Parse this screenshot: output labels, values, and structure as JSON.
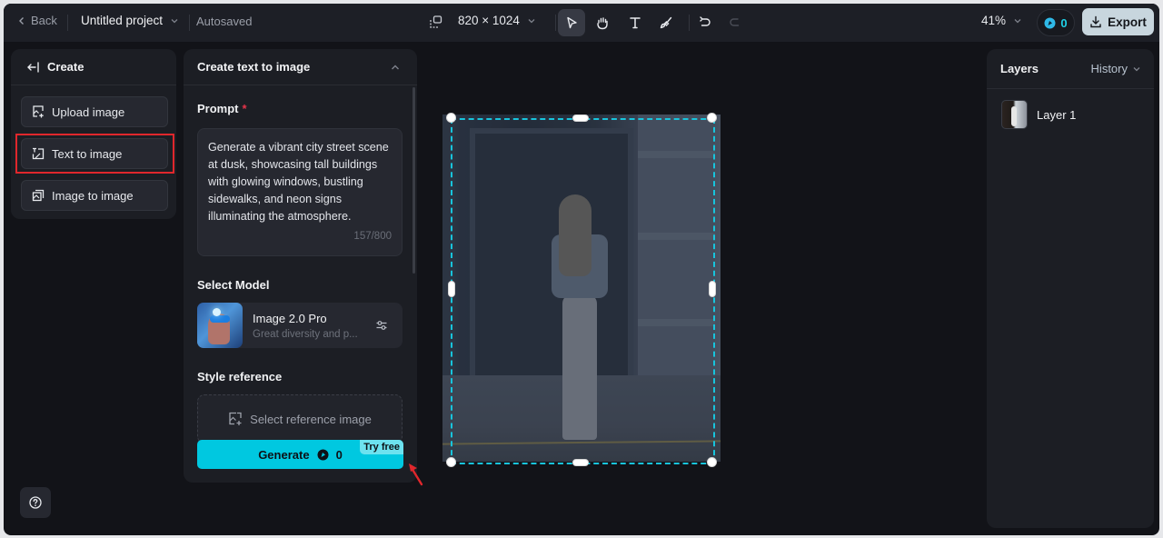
{
  "topbar": {
    "back_label": "Back",
    "project_name": "Untitled project",
    "save_status": "Autosaved",
    "canvas_size": "820 × 1024",
    "tools": [
      {
        "name": "select-tool",
        "icon": "cursor-arrow-icon",
        "active": true
      },
      {
        "name": "hand-tool",
        "icon": "hand-icon",
        "active": false
      },
      {
        "name": "text-tool",
        "icon": "text-T-icon",
        "active": false
      },
      {
        "name": "brush-tool",
        "icon": "brush-icon",
        "active": false
      }
    ],
    "undo_icon": "undo-icon",
    "redo_icon": "redo-icon",
    "zoom_level": "41%",
    "credits": "0",
    "export_label": "Export"
  },
  "create_panel": {
    "title": "Create",
    "items": [
      {
        "label": "Upload image",
        "icon": "upload-image-icon",
        "selected": false
      },
      {
        "label": "Text to image",
        "icon": "text-to-image-icon",
        "selected": true
      },
      {
        "label": "Image to image",
        "icon": "image-to-image-icon",
        "selected": false
      }
    ]
  },
  "t2i_panel": {
    "title": "Create text to image",
    "prompt_label": "Prompt",
    "prompt_required_mark": "*",
    "prompt_value": "Generate a vibrant city street scene at dusk, showcasing tall buildings with glowing windows, bustling sidewalks, and neon signs illuminating the atmosphere.",
    "prompt_count": "157/800",
    "model_label": "Select Model",
    "model_name": "Image 2.0 Pro",
    "model_desc": "Great diversity and p...",
    "style_label": "Style reference",
    "style_placeholder": "Select reference image",
    "generate_label": "Generate",
    "generate_cost": "0",
    "try_free_badge": "Try free"
  },
  "layers_panel": {
    "title": "Layers",
    "history_label": "History",
    "layers": [
      {
        "name": "Layer 1"
      }
    ]
  },
  "colors": {
    "accent": "#00c8e0",
    "selection": "#18c4dc",
    "highlight_box": "#e0272c",
    "background": "#121318",
    "panel": "#1c1e24"
  }
}
